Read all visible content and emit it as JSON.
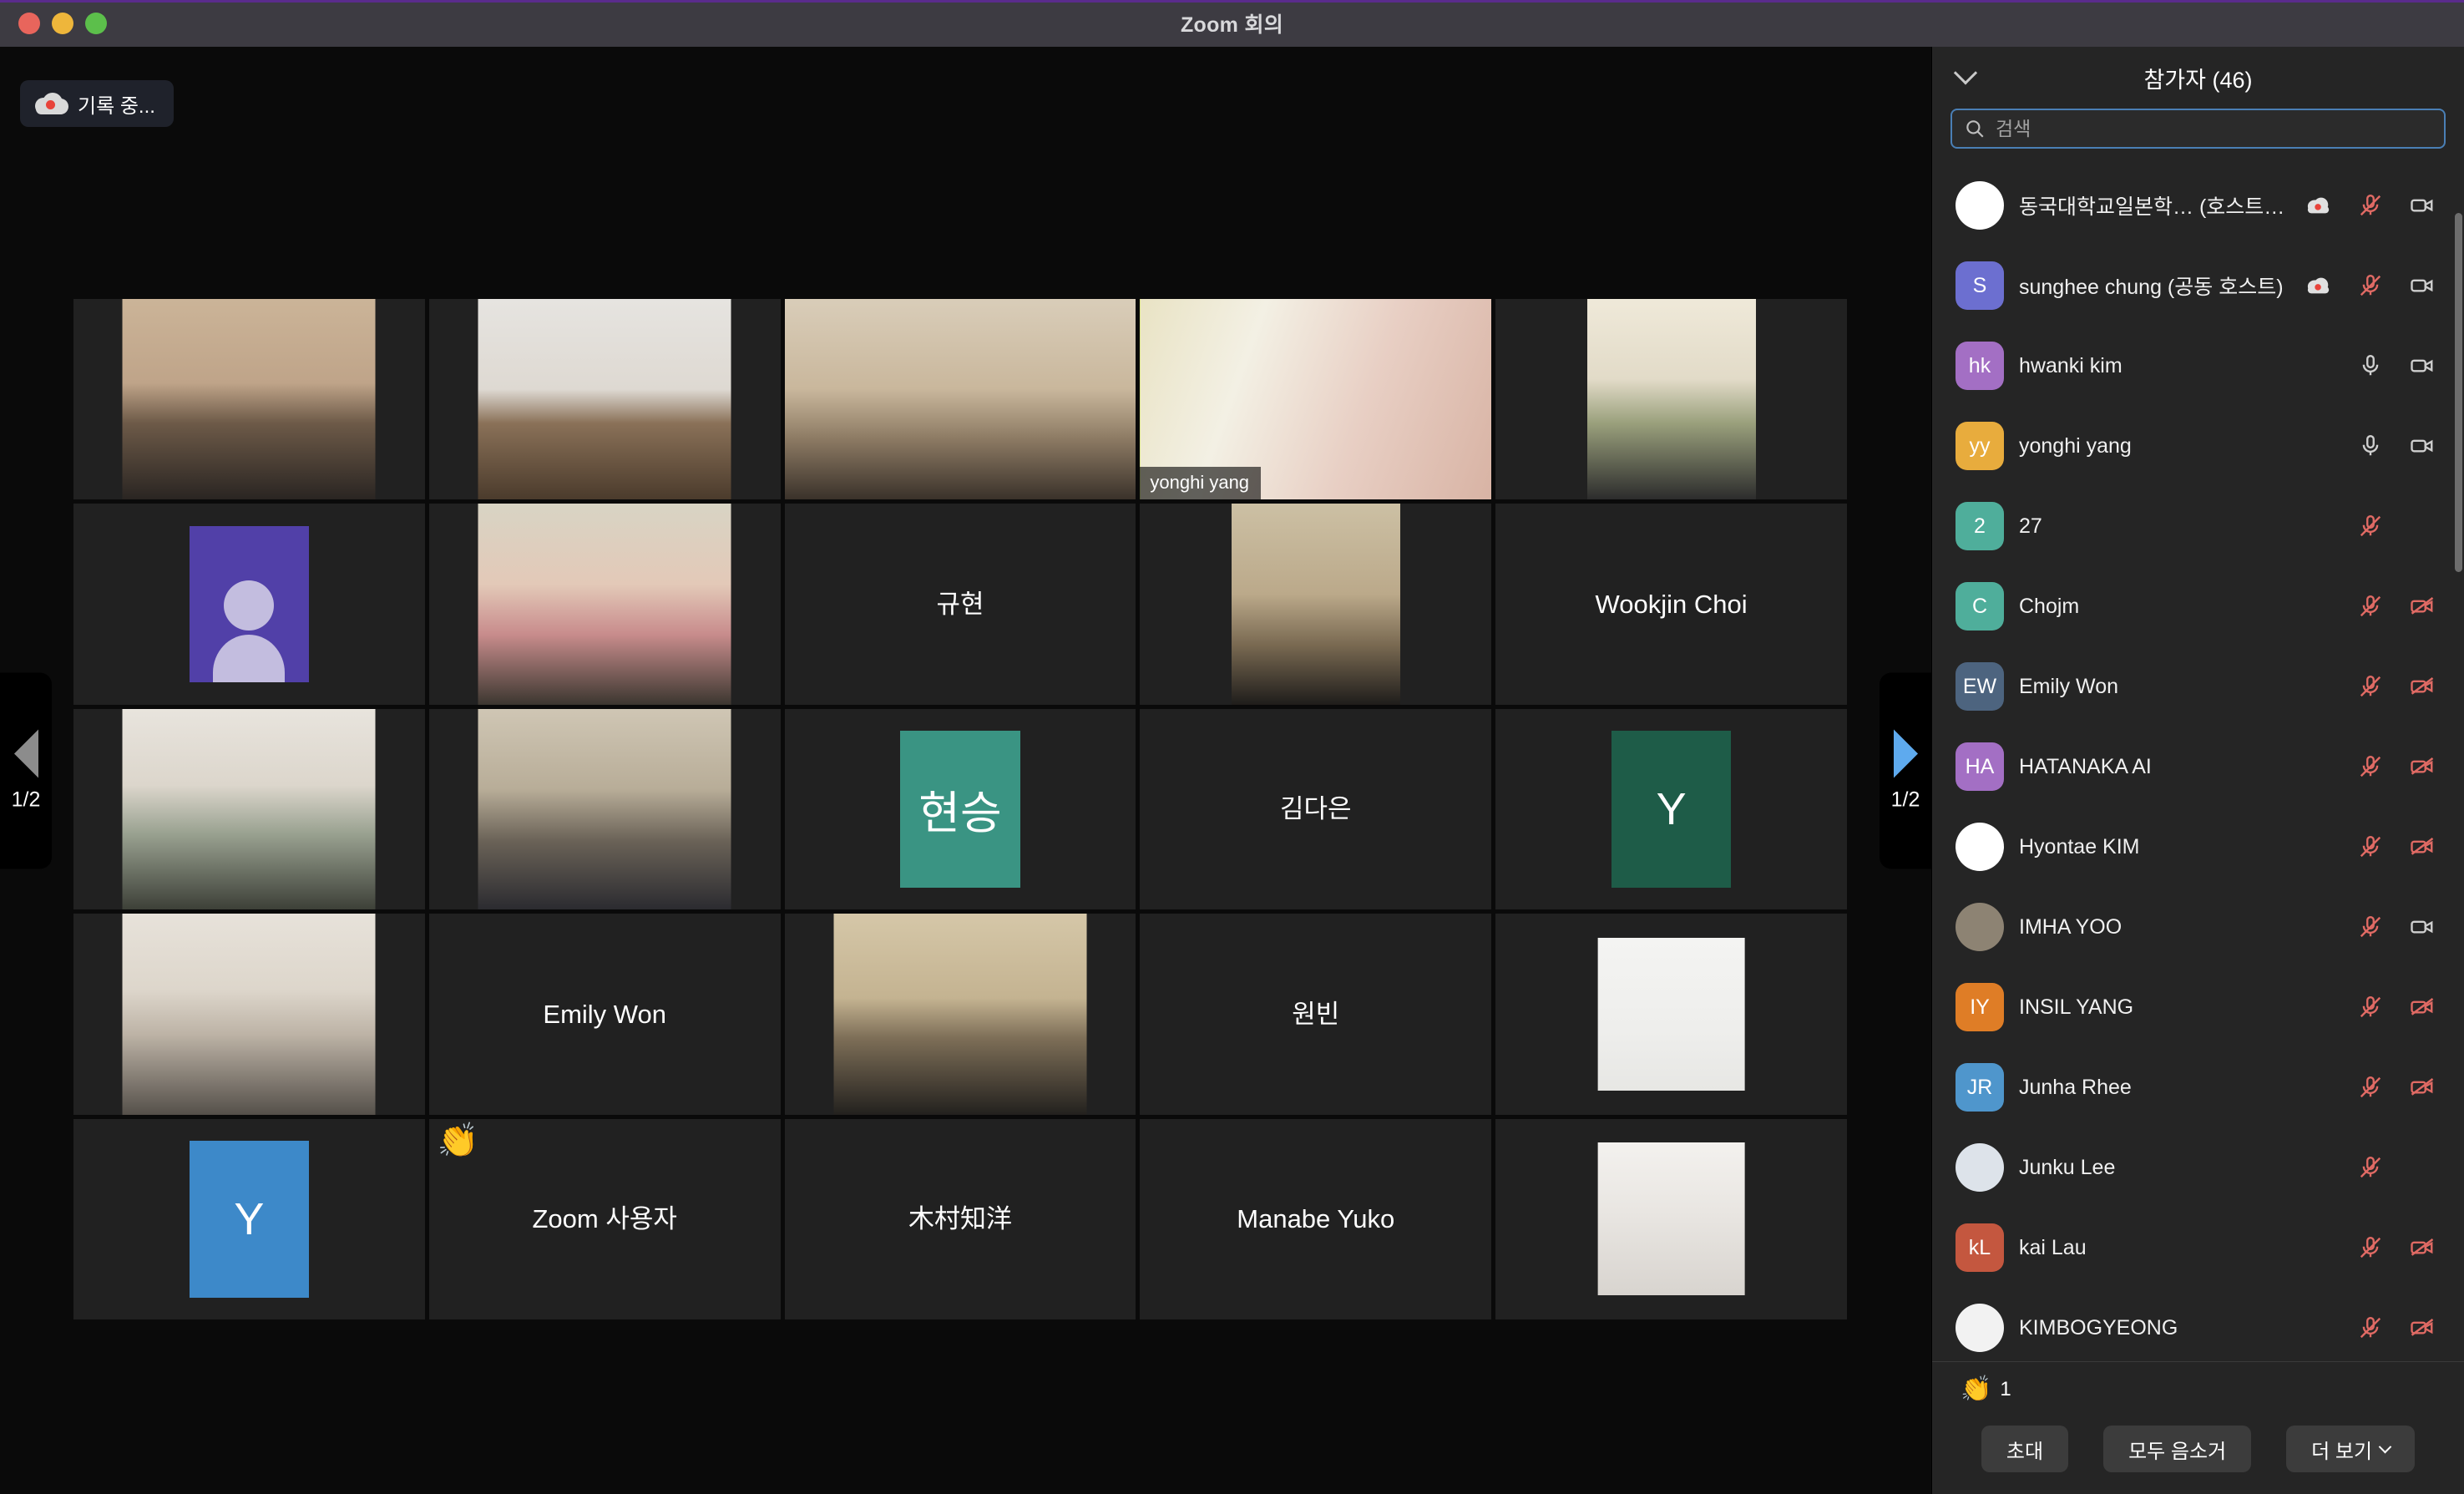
{
  "window": {
    "title": "Zoom 회의",
    "traffic_lights": [
      "close",
      "minimize",
      "maximize"
    ]
  },
  "recording": {
    "label": "기록 중...",
    "icon": "cloud-record-icon"
  },
  "stage": {
    "pager_left": {
      "icon": "triangle-left-icon",
      "page": "1/2",
      "color": "#8c8c8c"
    },
    "pager_right": {
      "icon": "triangle-right-icon",
      "page": "1/2",
      "color": "#5eaaee"
    },
    "speaking_border_color": "#cfe065",
    "tiles": [
      {
        "kind": "video",
        "name": "",
        "show_name": false,
        "media": "woman-bookshelf",
        "width": "mid"
      },
      {
        "kind": "video",
        "name": "",
        "show_name": false,
        "media": "person-whiteboard",
        "width": "mid"
      },
      {
        "kind": "video",
        "name": "",
        "show_name": false,
        "media": "woman-cat-bed",
        "width": "wide"
      },
      {
        "kind": "video",
        "name": "yonghi yang",
        "show_name": true,
        "media": "woman-flowers",
        "width": "wide",
        "speaking": true
      },
      {
        "kind": "video",
        "name": "",
        "show_name": false,
        "media": "person-mask",
        "width": "narrow"
      },
      {
        "kind": "avatar-silhouette",
        "name": "",
        "show_name": false,
        "color": "#5140a8"
      },
      {
        "kind": "video",
        "name": "",
        "show_name": false,
        "media": "woman-piano",
        "width": "mid"
      },
      {
        "kind": "name",
        "name": "규현",
        "show_name": true
      },
      {
        "kind": "video",
        "name": "",
        "show_name": false,
        "media": "man-library",
        "width": "narrow"
      },
      {
        "kind": "name",
        "name": "Wookjin Choi",
        "show_name": true
      },
      {
        "kind": "video",
        "name": "",
        "show_name": false,
        "media": "woman-room",
        "width": "mid"
      },
      {
        "kind": "video",
        "name": "",
        "show_name": false,
        "media": "man-blur",
        "width": "mid"
      },
      {
        "kind": "avatar-initial",
        "name": "현승",
        "show_name": true,
        "color": "#3a9483",
        "initial": "현승"
      },
      {
        "kind": "name",
        "name": "김다은",
        "show_name": true
      },
      {
        "kind": "avatar-initial",
        "name": "Y",
        "show_name": true,
        "color": "#1e5c48",
        "initial": "Y"
      },
      {
        "kind": "video",
        "name": "",
        "show_name": false,
        "media": "man-mask-kitchen",
        "width": "mid"
      },
      {
        "kind": "name",
        "name": "Emily Won",
        "show_name": true
      },
      {
        "kind": "video",
        "name": "",
        "show_name": false,
        "media": "man-suit-books",
        "width": "mid"
      },
      {
        "kind": "name",
        "name": "원빈",
        "show_name": true
      },
      {
        "kind": "image",
        "name": "",
        "show_name": false,
        "media": "hanbok-drawing"
      },
      {
        "kind": "avatar-initial",
        "name": "Y",
        "show_name": true,
        "color": "#3d89c9",
        "initial": "Y"
      },
      {
        "kind": "name",
        "name": "Zoom 사용자",
        "show_name": true,
        "reaction": "👏"
      },
      {
        "kind": "name",
        "name": "木村知洋",
        "show_name": true
      },
      {
        "kind": "name",
        "name": "Manabe Yuko",
        "show_name": true
      },
      {
        "kind": "image",
        "name": "",
        "show_name": false,
        "media": "cartoon-avatar-man"
      }
    ]
  },
  "panel": {
    "collapse_icon": "chevron-down-icon",
    "title": "참가자 (46)",
    "search": {
      "icon": "search-icon",
      "placeholder": "검색",
      "value": ""
    },
    "participants": [
      {
        "name": "동국대학교일본학…",
        "role": "(호스트, 나)",
        "avatar_kind": "photo",
        "avatar_text": "",
        "avatar_color": "#ffffff",
        "recording": true,
        "mic": "muted",
        "video": "on"
      },
      {
        "name": "sunghee chung",
        "role": "(공동 호스트)",
        "avatar_kind": "initials",
        "avatar_text": "S",
        "avatar_color": "#6c6fd0",
        "recording": true,
        "mic": "muted",
        "video": "on"
      },
      {
        "name": "hwanki kim",
        "role": "",
        "avatar_kind": "initials",
        "avatar_text": "hk",
        "avatar_color": "#a36fc4",
        "recording": false,
        "mic": "on",
        "video": "on"
      },
      {
        "name": "yonghi yang",
        "role": "",
        "avatar_kind": "initials",
        "avatar_text": "yy",
        "avatar_color": "#e8ac3d",
        "recording": false,
        "mic": "on",
        "video": "on"
      },
      {
        "name": "27",
        "role": "",
        "avatar_kind": "initials",
        "avatar_text": "2",
        "avatar_color": "#4fae9b",
        "recording": false,
        "mic": "muted",
        "video": "none"
      },
      {
        "name": "Chojm",
        "role": "",
        "avatar_kind": "initials",
        "avatar_text": "C",
        "avatar_color": "#4fae9b",
        "recording": false,
        "mic": "muted",
        "video": "off"
      },
      {
        "name": "Emily Won",
        "role": "",
        "avatar_kind": "initials",
        "avatar_text": "EW",
        "avatar_color": "#4d647f",
        "recording": false,
        "mic": "muted",
        "video": "off"
      },
      {
        "name": "HATANAKA AI",
        "role": "",
        "avatar_kind": "initials",
        "avatar_text": "HA",
        "avatar_color": "#a36fc4",
        "recording": false,
        "mic": "muted",
        "video": "off"
      },
      {
        "name": "Hyontae KIM",
        "role": "",
        "avatar_kind": "photo",
        "avatar_text": "",
        "avatar_color": "#ffffff",
        "recording": false,
        "mic": "muted",
        "video": "off"
      },
      {
        "name": "IMHA YOO",
        "role": "",
        "avatar_kind": "photo",
        "avatar_text": "",
        "avatar_color": "#8d8373",
        "recording": false,
        "mic": "muted",
        "video": "on"
      },
      {
        "name": "INSIL YANG",
        "role": "",
        "avatar_kind": "initials",
        "avatar_text": "IY",
        "avatar_color": "#df7d26",
        "recording": false,
        "mic": "muted",
        "video": "off"
      },
      {
        "name": "Junha Rhee",
        "role": "",
        "avatar_kind": "initials",
        "avatar_text": "JR",
        "avatar_color": "#4f96cc",
        "recording": false,
        "mic": "muted",
        "video": "off"
      },
      {
        "name": "Junku Lee",
        "role": "",
        "avatar_kind": "photo",
        "avatar_text": "",
        "avatar_color": "#dde3ea",
        "recording": false,
        "mic": "muted",
        "video": "none"
      },
      {
        "name": "kai Lau",
        "role": "",
        "avatar_kind": "initials",
        "avatar_text": "kL",
        "avatar_color": "#c4573f",
        "recording": false,
        "mic": "muted",
        "video": "off"
      },
      {
        "name": "KIMBOGYEONG",
        "role": "",
        "avatar_kind": "photo",
        "avatar_text": "",
        "avatar_color": "#f2f2f2",
        "recording": false,
        "mic": "muted",
        "video": "off"
      }
    ],
    "reactions": {
      "emoji": "👏",
      "count": "1"
    },
    "footer": {
      "invite": "초대",
      "mute_all": "모두 음소거",
      "more": "더 보기"
    }
  }
}
